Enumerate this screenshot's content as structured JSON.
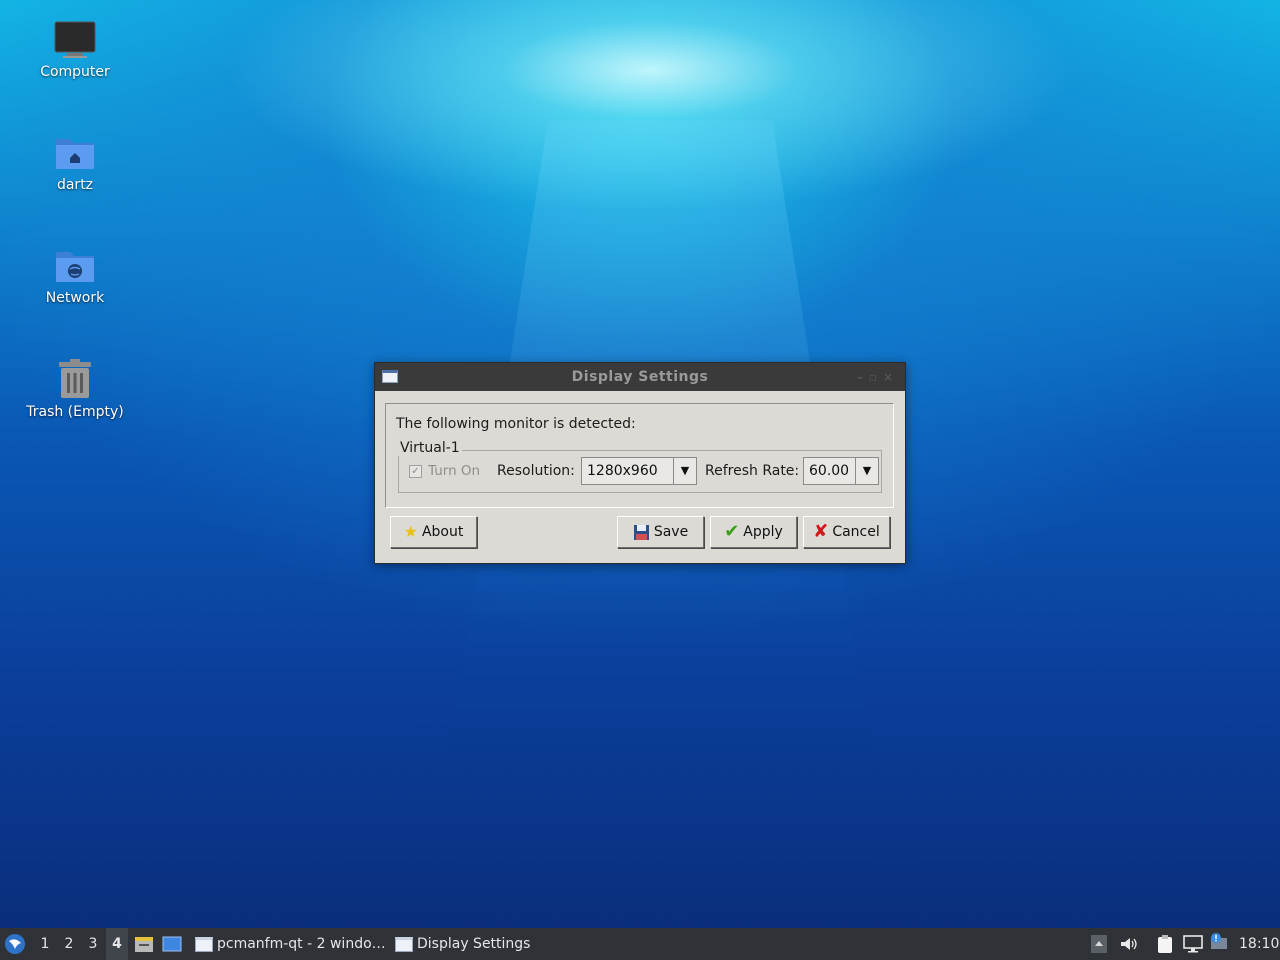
{
  "desktop": {
    "icons": [
      {
        "label": "Computer",
        "icon": "monitor-icon"
      },
      {
        "label": "dartz",
        "icon": "home-folder-icon"
      },
      {
        "label": "Network",
        "icon": "network-folder-icon"
      },
      {
        "label": "Trash (Empty)",
        "icon": "trash-icon"
      }
    ]
  },
  "dialog": {
    "title": "Display Settings",
    "detected_text": "The following monitor is detected:",
    "monitor_name": "Virtual-1",
    "turn_on_label": "Turn On",
    "turn_on_checked": true,
    "resolution_label": "Resolution:",
    "resolution_value": "1280x960",
    "refresh_label": "Refresh Rate:",
    "refresh_value": "60.00",
    "buttons": {
      "about": "About",
      "save": "Save",
      "apply": "Apply",
      "cancel": "Cancel"
    }
  },
  "taskbar": {
    "workspaces": [
      "1",
      "2",
      "3",
      "4"
    ],
    "active_workspace": "4",
    "tasks": [
      {
        "label": "pcmanfm-qt - 2 windo…"
      },
      {
        "label": "Display Settings"
      }
    ],
    "clock": "18:10"
  },
  "colors": {
    "taskbar_bg": "#2f3237",
    "titlebar_bg": "#3a3a3a",
    "dialog_bg": "#dcdad5",
    "cancel_icon": "#d01818",
    "apply_icon": "#3aa018"
  }
}
